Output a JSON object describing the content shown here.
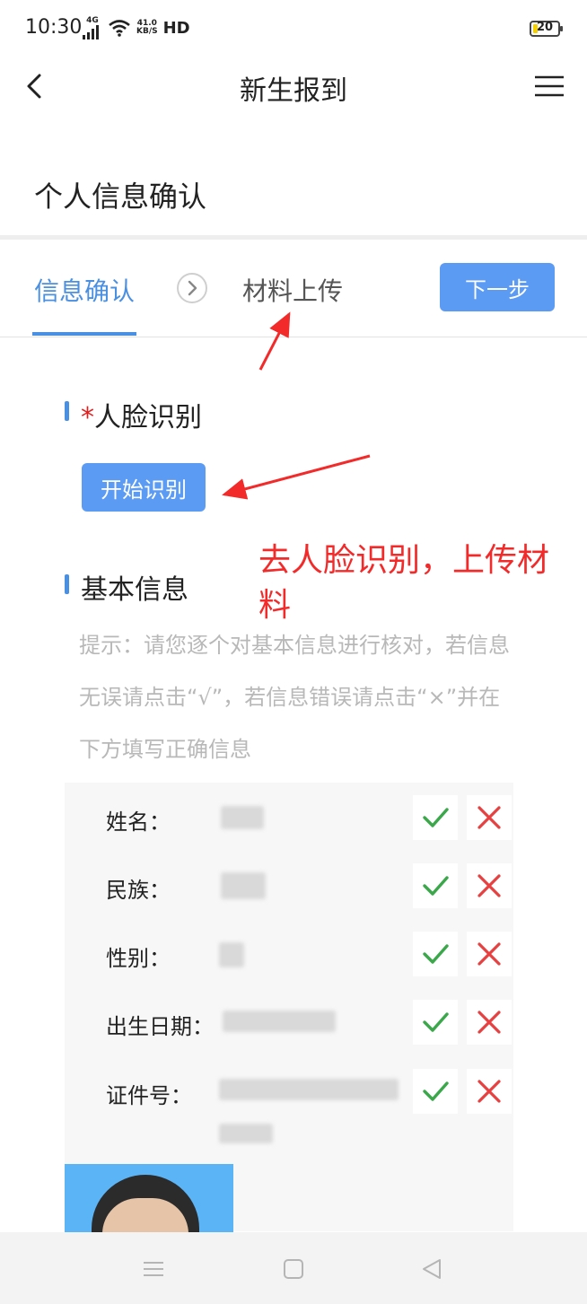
{
  "status_bar": {
    "time": "10:30",
    "signal_label": "4G",
    "net_speed_value": "41.0",
    "net_speed_unit": "KB/S",
    "hd_label": "HD",
    "battery_level": "20",
    "battery_fill_color": "#f4d000"
  },
  "nav": {
    "title": "新生报到",
    "back_icon": "chevron-left-icon",
    "menu_icon": "hamburger-menu-icon"
  },
  "section": {
    "title": "个人信息确认"
  },
  "steps": {
    "step1": "信息确认",
    "step2": "材料上传",
    "arrow_icon": "chevron-right-circle-icon",
    "next_button": "下一步",
    "active_color": "#4a90e2"
  },
  "face": {
    "required_mark": "*",
    "title": "人脸识别",
    "start_button": "开始识别"
  },
  "basic_info": {
    "title": "基本信息",
    "hint": "提示：请您逐个对基本信息进行核对，若信息无误请点击“√”，若信息错误请点击“×”并在下方填写正确信息",
    "rows": [
      {
        "label": "姓名："
      },
      {
        "label": "民族："
      },
      {
        "label": "性别："
      },
      {
        "label": "出生日期："
      },
      {
        "label": "证件号："
      }
    ],
    "confirm_icon": "check-icon",
    "reject_icon": "cross-icon",
    "confirm_color": "#3aa84a",
    "reject_color": "#e84040"
  },
  "annotation": {
    "text": "去人脸识别，上传材料",
    "color": "#f22a2a"
  },
  "bottom_nav": {
    "menu_icon": "menu-lines-icon",
    "home_icon": "square-home-icon",
    "back_icon": "triangle-back-icon"
  }
}
